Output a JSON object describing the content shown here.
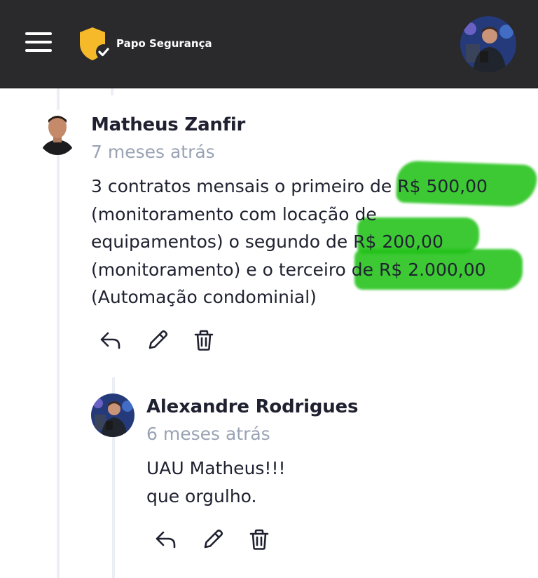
{
  "header": {
    "menu_icon": "hamburger-menu-icon",
    "brand_name": "Papo Segurança",
    "brand_logo_icon": "shield-check-icon",
    "brand_color": "#f6b92a",
    "background": "#2a292b"
  },
  "comments": [
    {
      "author": "Matheus Zanfir",
      "time": "7 meses atrás",
      "lines": [
        "3 contratos mensais o primeiro de R$ 500,00",
        "(monitoramento com locação de",
        "equipamentos) o segundo de R$ 200,00",
        "(monitoramento) e o terceiro de R$ 2.000,00",
        "(Automação condominial)"
      ],
      "highlight_color": "#22c218"
    },
    {
      "author": "Alexandre Rodrigues",
      "time": "6 meses atrás",
      "lines": [
        "UAU Matheus!!!",
        "que orgulho."
      ]
    }
  ],
  "actions": {
    "reply_icon": "reply-icon",
    "edit_icon": "pencil-icon",
    "delete_icon": "trash-icon"
  },
  "colors": {
    "text": "#1f2130",
    "muted": "#9aa3b4",
    "thread_line": "#eceef6"
  }
}
